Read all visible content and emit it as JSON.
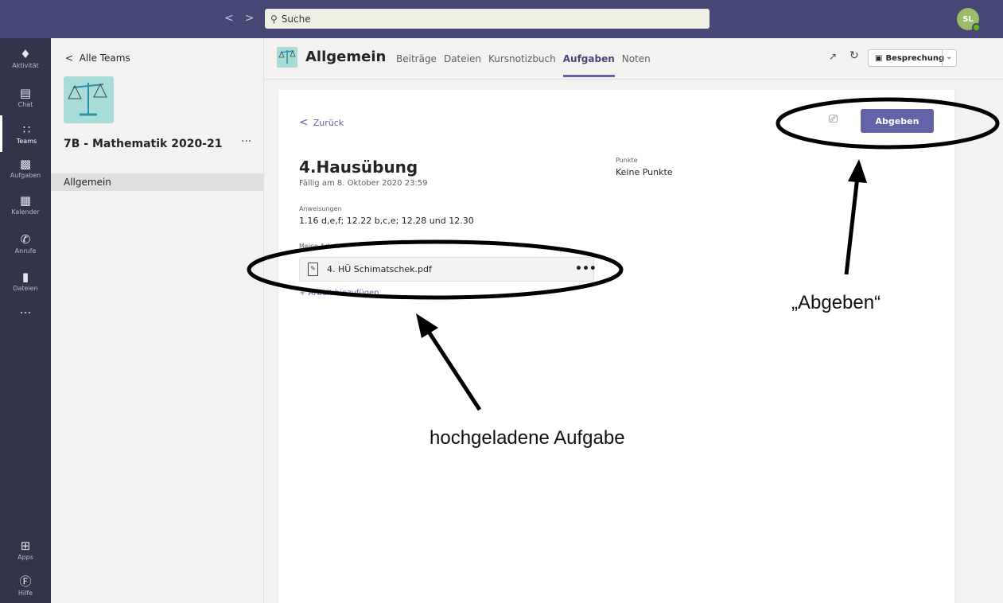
{
  "topbar": {
    "search_placeholder": "Suche",
    "back_icon": "chevron-left",
    "forward_icon": "chevron-right",
    "avatar_initials": "SL"
  },
  "rail": {
    "items": [
      {
        "label": "Aktivität",
        "icon": "bell"
      },
      {
        "label": "Chat",
        "icon": "chat"
      },
      {
        "label": "Teams",
        "icon": "teams",
        "active": true
      },
      {
        "label": "Aufgaben",
        "icon": "assignments"
      },
      {
        "label": "Kalender",
        "icon": "calendar"
      },
      {
        "label": "Anrufe",
        "icon": "phone"
      },
      {
        "label": "Dateien",
        "icon": "file"
      },
      {
        "label": "Apps",
        "icon": "apps"
      },
      {
        "label": "Hilfe",
        "icon": "help"
      }
    ],
    "more": "..."
  },
  "team_panel": {
    "back_label": "Alle Teams",
    "team_name": "7B - Mathematik 2020-21",
    "more": "···",
    "channel": "Allgemein"
  },
  "channel_header": {
    "title": "Allgemein",
    "tabs": [
      {
        "label": "Beiträge"
      },
      {
        "label": "Dateien"
      },
      {
        "label": "Kursnotizbuch"
      },
      {
        "label": "Aufgaben",
        "active": true
      },
      {
        "label": "Noten"
      }
    ],
    "meeting_label": "Besprechung"
  },
  "assignment": {
    "back_label": "Zurück",
    "submit_label": "Abgeben",
    "title": "4.Hausübung",
    "due": "Fällig am 8. Oktober 2020 23:59",
    "points_label": "Punkte",
    "points_value": "Keine Punkte",
    "instructions_label": "Anweisungen",
    "instructions": "1.16 d,e,f; 12.22 b,c,e; 12.28 und 12.30",
    "work_label": "Meine Arbeit",
    "file_name": "4. HÜ Schimatschek.pdf",
    "file_more": "•••",
    "add_work_label": "+ Arbeit hinzufügen"
  },
  "annotations": {
    "submit_note": "„Abgeben“",
    "upload_note": "hochgeladene Aufgabe"
  }
}
